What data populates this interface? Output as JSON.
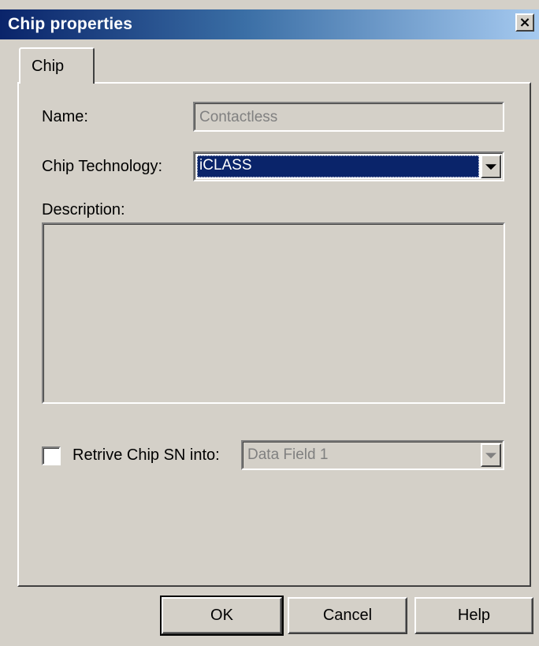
{
  "window": {
    "title": "Chip properties",
    "close_label": "×"
  },
  "tabs": [
    {
      "label": "Chip",
      "selected": true
    }
  ],
  "form": {
    "name_label": "Name:",
    "name_value": "Contactless",
    "name_disabled": true,
    "technology_label": "Chip Technology:",
    "technology_value": "iCLASS",
    "description_label": "Description:",
    "description_value": "",
    "retrieve_label": "Retrive Chip SN into:",
    "retrieve_checked": false,
    "retrieve_target_value": "Data Field 1",
    "retrieve_target_disabled": true
  },
  "buttons": {
    "ok_label": "OK",
    "cancel_label": "Cancel",
    "help_label": "Help"
  },
  "colors": {
    "title_bar_start": "#0a246a",
    "title_bar_end": "#a6caf0",
    "selection_bg": "#0a246a",
    "face": "#d4d0c8",
    "disabled_text": "#808080"
  },
  "icons": {
    "close": "close-icon",
    "dropdown": "chevron-down-icon"
  }
}
